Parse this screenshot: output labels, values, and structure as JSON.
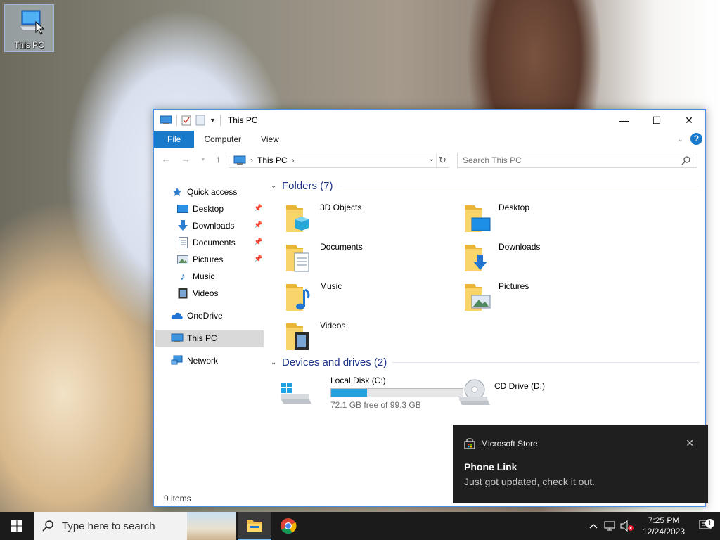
{
  "desktop": {
    "icon_label": "This PC"
  },
  "window": {
    "title": "This PC",
    "tabs": [
      "File",
      "Computer",
      "View"
    ],
    "address": {
      "crumb": "This PC"
    },
    "search_placeholder": "Search This PC",
    "controls": {
      "minimize": "—",
      "maximize": "☐",
      "close": "✕"
    }
  },
  "nav": {
    "quick_access": "Quick access",
    "items": [
      {
        "label": "Desktop",
        "pinned": true
      },
      {
        "label": "Downloads",
        "pinned": true
      },
      {
        "label": "Documents",
        "pinned": true
      },
      {
        "label": "Pictures",
        "pinned": true
      },
      {
        "label": "Music",
        "pinned": false
      },
      {
        "label": "Videos",
        "pinned": false
      }
    ],
    "onedrive": "OneDrive",
    "this_pc": "This PC",
    "network": "Network"
  },
  "content": {
    "folders_header": "Folders (7)",
    "folders": [
      "3D Objects",
      "Desktop",
      "Documents",
      "Downloads",
      "Music",
      "Pictures",
      "Videos"
    ],
    "devices_header": "Devices and drives (2)",
    "drives": [
      {
        "name": "Local Disk (C:)",
        "free_text": "72.1 GB free of 99.3 GB",
        "used_fraction": 0.274
      },
      {
        "name": "CD Drive (D:)"
      }
    ]
  },
  "status": {
    "items": "9 items"
  },
  "toast": {
    "app": "Microsoft Store",
    "title": "Phone Link",
    "body": "Just got updated, check it out.",
    "close": "✕"
  },
  "taskbar": {
    "search_placeholder": "Type here to search",
    "time": "7:25 PM",
    "date": "12/24/2023",
    "notification_count": "1"
  },
  "colors": {
    "accent": "#1979ca",
    "drive_fill": "#26a0da",
    "group_header": "#1e3287",
    "toast_bg": "#1f1f1f"
  }
}
